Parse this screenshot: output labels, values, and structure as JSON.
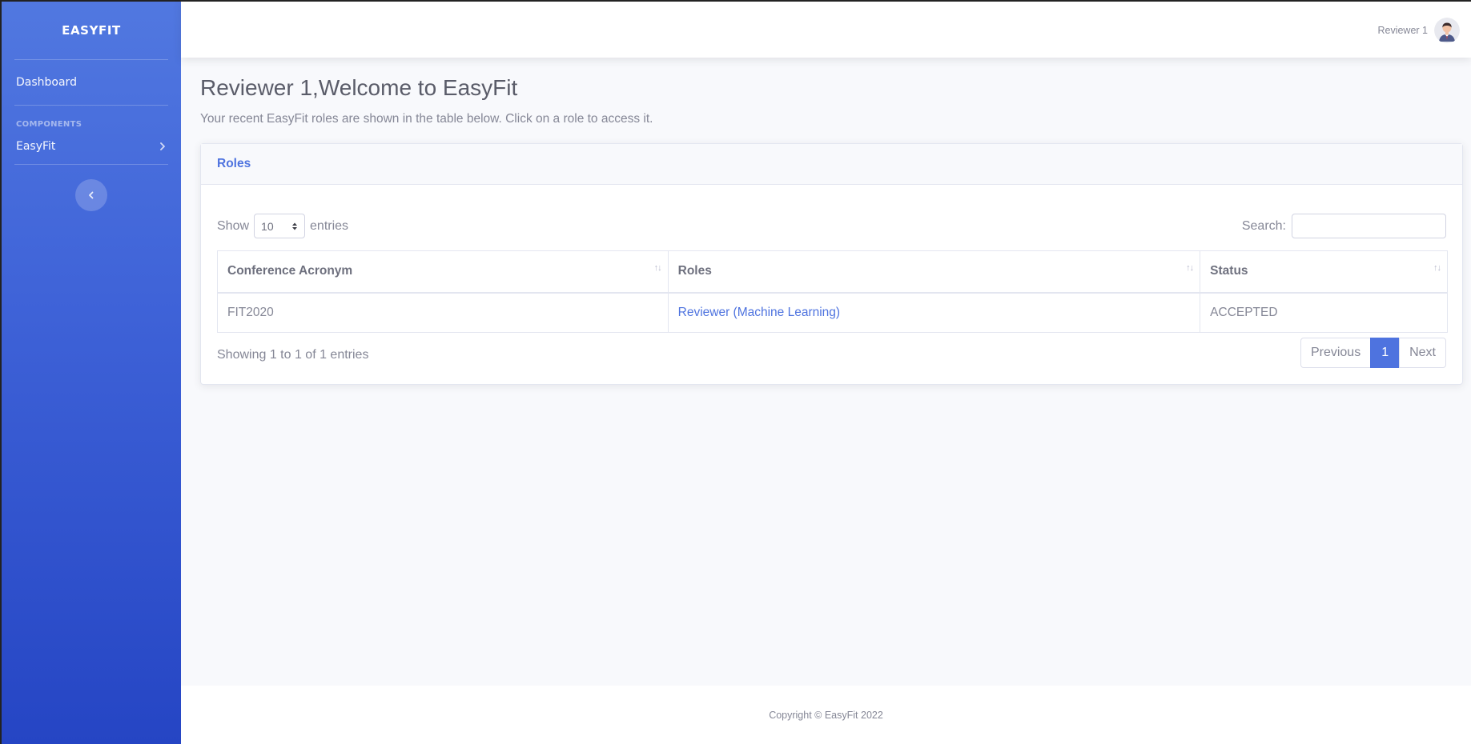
{
  "sidebar": {
    "brand": "EASYFIT",
    "dashboard_label": "Dashboard",
    "section_heading": "COMPONENTS",
    "easyfit_label": "EasyFit",
    "toggle_icon": "chevron-left-icon"
  },
  "topbar": {
    "user_name": "Reviewer 1",
    "avatar_icon": "user-avatar"
  },
  "main": {
    "title": "Reviewer 1,Welcome to EasyFit",
    "description": "Your recent EasyFit roles are shown in the table below. Click on a role to access it."
  },
  "card": {
    "title": "Roles",
    "show_label": "Show",
    "entries_value": "10",
    "entries_label": "entries",
    "search_label": "Search:",
    "search_value": "",
    "columns": [
      "Conference Acronym",
      "Roles",
      "Status"
    ],
    "rows": [
      {
        "acronym": "FIT2020",
        "role": "Reviewer (Machine Learning)",
        "status": "ACCEPTED"
      }
    ],
    "info": "Showing 1 to 1 of 1 entries",
    "pagination": {
      "previous": "Previous",
      "current": "1",
      "next": "Next"
    }
  },
  "footer": {
    "copyright": "Copyright © EasyFit 2022"
  },
  "colors": {
    "primary": "#4e73df",
    "sidebar_top": "#5178e0",
    "sidebar_bottom": "#2545c4",
    "text": "#858796",
    "heading": "#5a5c69"
  }
}
